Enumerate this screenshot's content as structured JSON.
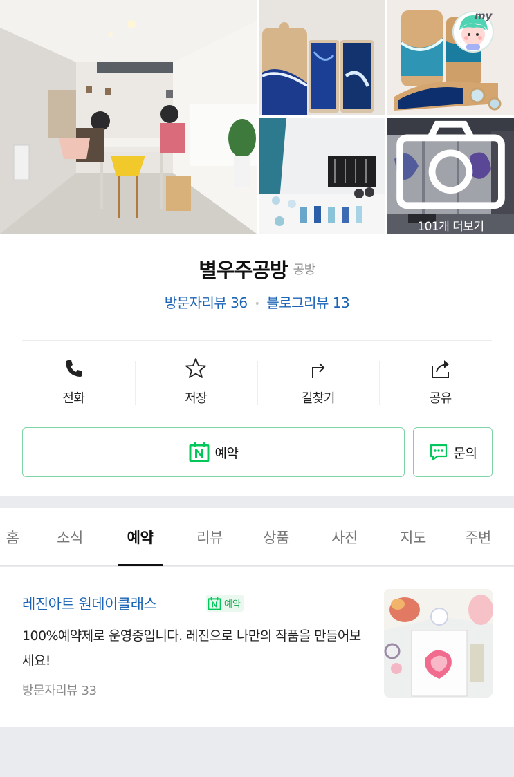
{
  "gallery": {
    "more_label": "101개 더보기",
    "my_badge_label": "my"
  },
  "place": {
    "name": "별우주공방",
    "category": "공방",
    "visitor_review_label": "방문자리뷰 36",
    "blog_review_label": "블로그리뷰 13"
  },
  "actions": [
    {
      "label": "전화",
      "icon": "phone-icon"
    },
    {
      "label": "저장",
      "icon": "star-icon"
    },
    {
      "label": "길찾기",
      "icon": "directions-icon"
    },
    {
      "label": "공유",
      "icon": "share-icon"
    }
  ],
  "buttons": {
    "reserve_label": "예약",
    "inquiry_label": "문의"
  },
  "tabs": [
    {
      "label": "홈"
    },
    {
      "label": "소식"
    },
    {
      "label": "예약"
    },
    {
      "label": "리뷰"
    },
    {
      "label": "상품"
    },
    {
      "label": "사진"
    },
    {
      "label": "지도"
    },
    {
      "label": "주변"
    }
  ],
  "booking_card": {
    "title": "레진아트 원데이클래스",
    "tag_label": "예약",
    "description": "100%예약제로 운영중입니다. 레진으로 나만의 작품을 만들어보세요!",
    "meta": "방문자리뷰 33"
  },
  "colors": {
    "link_blue": "#1c64b6",
    "naver_green": "#03c75a",
    "button_border": "#7ed4a5"
  }
}
